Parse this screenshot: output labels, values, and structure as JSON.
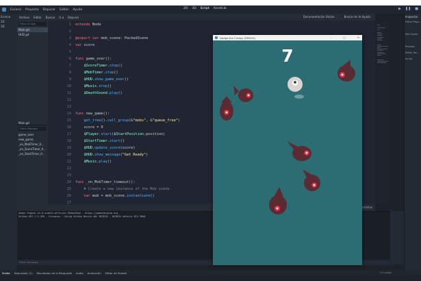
{
  "menu": [
    "Escena",
    "Proyecto",
    "Depurar",
    "Editor",
    "Ayuda"
  ],
  "modes": [
    "2D",
    "3D",
    "Script",
    "AssetLib"
  ],
  "active_mode": "Script",
  "left_dock": {
    "label": "Escena",
    "rows": [
      "2D",
      "3D",
      "",
      "",
      "",
      "",
      "",
      "",
      "",
      "",
      "",
      "",
      "",
      "",
      ""
    ]
  },
  "scripts_panel": {
    "header_items": [
      "Archivo",
      "Editar",
      "Buscar",
      "Ir a",
      "Depurar"
    ],
    "filter_placeholder": "Filtrar Scripts",
    "files": [
      "Main.gd",
      "HUD.gd"
    ],
    "methods_title": "Main.gd",
    "methods_filter": "Filtrar Métodos",
    "methods": [
      "game_over",
      "new_game",
      "_on_MobTimer_ti...",
      "_on_ScoreTimer_ti...",
      "_on_StartTimer_ti..."
    ]
  },
  "editor_toolbar": {
    "items": [
      "Archivo",
      "Editar",
      "Buscar",
      "Ir a",
      "Depurar"
    ],
    "right": [
      "Documentación Online",
      "Buscar en la Ayuda"
    ]
  },
  "code": [
    {
      "n": "1",
      "t": "extends Node"
    },
    {
      "n": "2",
      "t": ""
    },
    {
      "n": "3",
      "t": "@export var mob_scene: PackedScene"
    },
    {
      "n": "4",
      "t": "var score"
    },
    {
      "n": "5",
      "t": ""
    },
    {
      "n": "6",
      "t": "func game_over():"
    },
    {
      "n": "7",
      "t": "    $ScoreTimer.stop()"
    },
    {
      "n": "8",
      "t": "    $MobTimer.stop()"
    },
    {
      "n": "9",
      "t": "    $HUD.show_game_over()"
    },
    {
      "n": "10",
      "t": "    $Music.stop()"
    },
    {
      "n": "11",
      "t": "    $DeathSound.play()"
    },
    {
      "n": "12",
      "t": ""
    },
    {
      "n": "13",
      "t": ""
    },
    {
      "n": "14",
      "t": "func new_game():"
    },
    {
      "n": "15",
      "t": "    get_tree().call_group(&\"mobs\", &\"queue_free\")"
    },
    {
      "n": "16",
      "t": "    score = 0"
    },
    {
      "n": "17",
      "t": "    $Player.start($StartPosition.position)"
    },
    {
      "n": "18",
      "t": "    $StartTimer.start()"
    },
    {
      "n": "19",
      "t": "    $HUD.update_score(score)"
    },
    {
      "n": "20",
      "t": "    $HUD.show_message(\"Get Ready\")"
    },
    {
      "n": "21",
      "t": "    $Music.play()"
    },
    {
      "n": "22",
      "t": ""
    },
    {
      "n": "23",
      "t": ""
    },
    {
      "n": "24",
      "t": "func _on_MobTimer_timeout():"
    },
    {
      "n": "25",
      "t": "    # Create a new instance of the Mob scene."
    },
    {
      "n": "26",
      "t": "    var mob = mob_scene.instantiate()"
    },
    {
      "n": "27",
      "t": ""
    }
  ],
  "editor_status": {
    "position": "1 : 1",
    "indent": "Pestañas"
  },
  "output": {
    "lines": [
      "Godot Engine v4.0.stable.official.92bee43ad - https://godotengine.org",
      "Vulkan API 1.3.205 - Forward+ - Using Vulkan Device #0: NVIDIA - NVIDIA GeForce RTX 3060",
      "",
      ""
    ],
    "filter_placeholder": "Filtrar Mensajes"
  },
  "bottom_tabs": [
    "Salida",
    "Depurador (1)",
    "Resultados de la Búsqueda",
    "Audio",
    "Animación",
    "Editor de Shader"
  ],
  "version": "4.0.stable",
  "right_dock": {
    "tab": "Inspector",
    "rows": [
      "Filtrar Prop...",
      "",
      "Mid Scene",
      "",
      "Process",
      "Editor De...",
      "Script"
    ]
  },
  "game": {
    "title": "Dodge the Creeps (DEBUG)",
    "score": "7",
    "colors": {
      "background": "#2c6d74",
      "mob": "#5a2b33",
      "eye": "#e03049",
      "player": "#d9d4cf"
    }
  },
  "colors": {
    "accent": "#478cbf",
    "keyword": "#ff7085",
    "function": "#57b3ff",
    "node": "#8fffdb",
    "string": "#ffeda1"
  }
}
